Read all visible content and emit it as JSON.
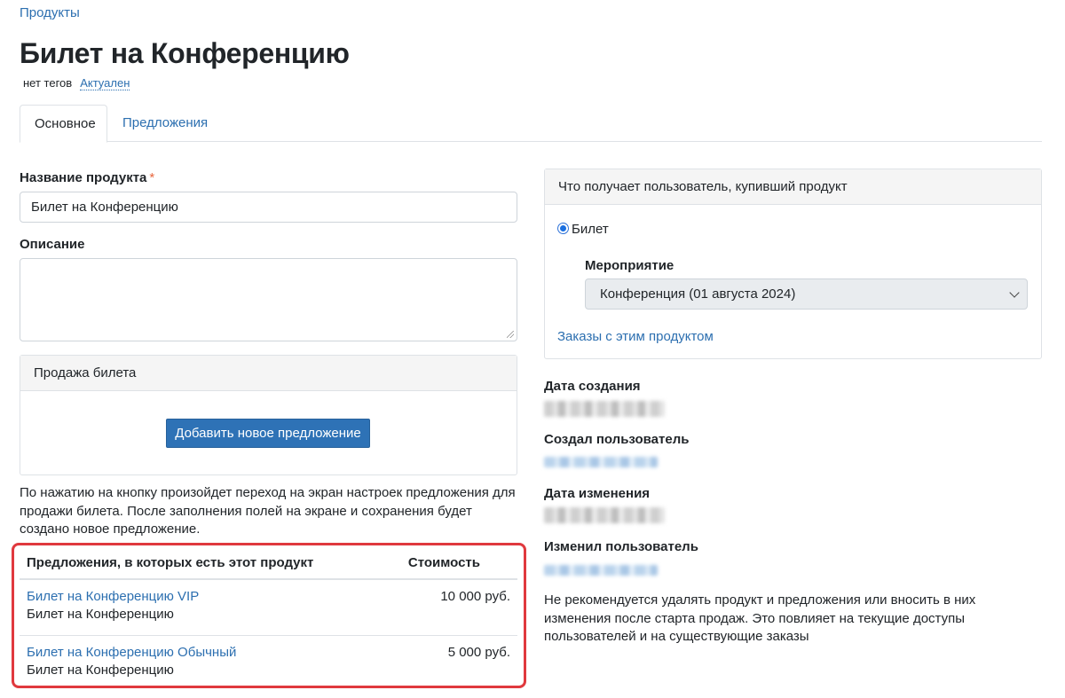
{
  "breadcrumb": {
    "products": "Продукты"
  },
  "page": {
    "title": "Билет на Конференцию",
    "tags": "нет тегов",
    "status": "Актуален"
  },
  "tabs": [
    {
      "label": "Основное",
      "active": true
    },
    {
      "label": "Предложения",
      "active": false
    }
  ],
  "form": {
    "name_label": "Название продукта",
    "required_mark": "*",
    "name_value": "Билет на Конференцию",
    "description_label": "Описание",
    "description_value": ""
  },
  "ticket_sale": {
    "header": "Продажа билета",
    "add_button": "Добавить новое предложение",
    "help_text": "По нажатию на кнопку произойдет переход на экран настроек предложения для продажи билета. После заполнения полей на экране и сохранения будет создано новое предложение."
  },
  "offers_table": {
    "col_name": "Предложения, в которых есть этот продукт",
    "col_price": "Стоимость",
    "rows": [
      {
        "offer": "Билет на Конференцию VIP",
        "product": "Билет на Конференцию",
        "price": "10 000 руб."
      },
      {
        "offer": "Билет на Конференцию Обычный",
        "product": "Билет на Конференцию",
        "price": "5 000 руб."
      }
    ]
  },
  "purchase_panel": {
    "header": "Что получает пользователь, купивший продукт",
    "radio_label": "Билет",
    "radio_checked": true,
    "event_label": "Мероприятие",
    "event_value": "Конференция (01 августа 2024)",
    "orders_link": "Заказы с этим продуктом"
  },
  "meta": {
    "created_label": "Дата создания",
    "created_by_label": "Создал пользователь",
    "modified_label": "Дата изменения",
    "modified_by_label": "Изменил пользователь"
  },
  "warning": "Не рекомендуется удалять продукт и предложения или вносить в них изменения после старта продаж. Это повлияет на текущие доступы пользователей и на существующие заказы",
  "colors": {
    "link": "#2c6fb0",
    "primary_button": "#2e72b6",
    "highlight_border": "#e0393e",
    "required": "#e8663d"
  }
}
